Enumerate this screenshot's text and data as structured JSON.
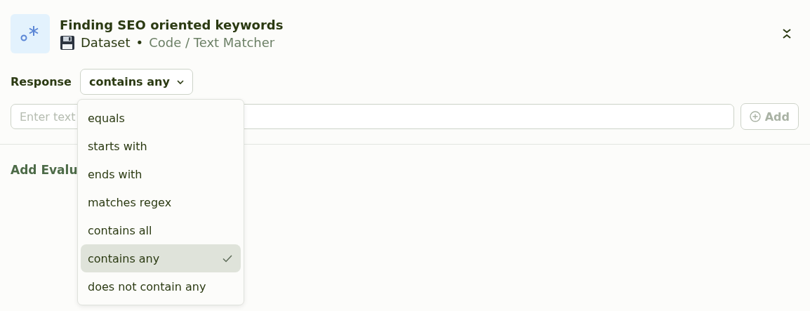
{
  "header": {
    "title": "Finding SEO oriented keywords",
    "source": "Dataset",
    "separator": "•",
    "path": "Code / Text Matcher"
  },
  "response": {
    "label": "Response",
    "value": "contains any"
  },
  "text_input": {
    "placeholder": "Enter text"
  },
  "add_button": {
    "label": "Add"
  },
  "section_title": "Add Evalu",
  "dropdown": {
    "options": [
      {
        "label": "equals",
        "selected": false
      },
      {
        "label": "starts with",
        "selected": false
      },
      {
        "label": "ends with",
        "selected": false
      },
      {
        "label": "matches regex",
        "selected": false
      },
      {
        "label": "contains all",
        "selected": false
      },
      {
        "label": "contains any",
        "selected": true
      },
      {
        "label": "does not contain any",
        "selected": false
      }
    ]
  }
}
